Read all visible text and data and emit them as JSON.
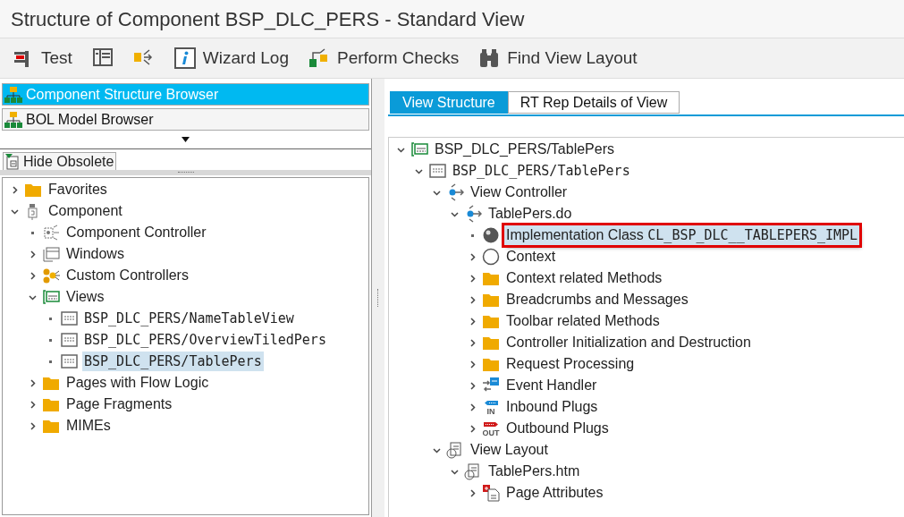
{
  "window": {
    "title": "Structure of Component BSP_DLC_PERS - Standard View"
  },
  "toolbar": [
    {
      "kind": "test",
      "label": "Test"
    },
    {
      "kind": "panel"
    },
    {
      "kind": "flow"
    },
    {
      "kind": "info",
      "label": "Wizard Log"
    },
    {
      "kind": "checks",
      "label": "Perform Checks"
    },
    {
      "kind": "binoculars",
      "label": "Find View Layout"
    }
  ],
  "browsers": [
    {
      "label": "Component Structure Browser",
      "selected": true
    },
    {
      "label": "BOL Model Browser",
      "selected": false
    }
  ],
  "hide_obsolete": {
    "label": "Hide Obsolete"
  },
  "left_tree": [
    {
      "kind": "folder",
      "label": "Favorites",
      "expanded": false,
      "selected": false
    },
    {
      "kind": "component",
      "label": "Component",
      "expanded": true,
      "selected": false,
      "children": [
        {
          "kind": "controller",
          "label": "Component Controller",
          "selected": false
        },
        {
          "kind": "windows",
          "label": "Windows",
          "expanded": false,
          "selected": false
        },
        {
          "kind": "custom",
          "label": "Custom Controllers",
          "expanded": false,
          "selected": false
        },
        {
          "kind": "views",
          "label": "Views",
          "expanded": true,
          "selected": false,
          "children": [
            {
              "kind": "view",
              "code": "BSP_DLC_PERS/NameTableView",
              "selected": false
            },
            {
              "kind": "view",
              "code": "BSP_DLC_PERS/OverviewTiledPers",
              "selected": false
            },
            {
              "kind": "view",
              "code": "BSP_DLC_PERS/TablePers",
              "selected": true
            }
          ]
        },
        {
          "kind": "folder",
          "label": "Pages with Flow Logic",
          "expanded": false,
          "selected": false
        },
        {
          "kind": "folder",
          "label": "Page Fragments",
          "expanded": false,
          "selected": false
        },
        {
          "kind": "folder",
          "label": "MIMEs",
          "expanded": false,
          "selected": false
        }
      ]
    }
  ],
  "tabs": [
    {
      "label": "View Structure",
      "selected": true
    },
    {
      "label": "RT Rep Details of View",
      "selected": false
    }
  ],
  "view_tree": [
    {
      "kind": "views",
      "label": "BSP_DLC_PERS/TablePers",
      "expanded": true,
      "selected": false,
      "children": [
        {
          "kind": "view",
          "code": "BSP_DLC_PERS/TablePers",
          "expanded": true,
          "selected": false,
          "children": [
            {
              "kind": "viewctl",
              "label": "View Controller",
              "expanded": true,
              "selected": false,
              "children": [
                {
                  "kind": "viewctl",
                  "label": "TablePers.do",
                  "expanded": true,
                  "selected": false,
                  "children": [
                    {
                      "kind": "impl",
                      "label": "Implementation Class ",
                      "code": "CL_BSP_DLC__TABLEPERS_IMPL",
                      "selected": true
                    },
                    {
                      "kind": "context",
                      "label": "Context",
                      "expanded": false,
                      "selected": false
                    },
                    {
                      "kind": "folder",
                      "label": "Context related Methods",
                      "expanded": false,
                      "selected": false
                    },
                    {
                      "kind": "folder",
                      "label": "Breadcrumbs and Messages",
                      "expanded": false,
                      "selected": false
                    },
                    {
                      "kind": "folder",
                      "label": "Toolbar related Methods",
                      "expanded": false,
                      "selected": false
                    },
                    {
                      "kind": "folder",
                      "label": "Controller Initialization and Destruction",
                      "expanded": false,
                      "selected": false
                    },
                    {
                      "kind": "folder",
                      "label": "Request Processing",
                      "expanded": false,
                      "selected": false
                    },
                    {
                      "kind": "event",
                      "label": "Event Handler",
                      "expanded": false,
                      "selected": false
                    },
                    {
                      "kind": "inbound",
                      "badge": "IN",
                      "label": "Inbound Plugs",
                      "expanded": false,
                      "selected": false
                    },
                    {
                      "kind": "outbound",
                      "badge": "OUT",
                      "label": "Outbound Plugs",
                      "expanded": false,
                      "selected": false
                    }
                  ]
                }
              ]
            },
            {
              "kind": "layout",
              "label": "View Layout",
              "expanded": true,
              "selected": false,
              "children": [
                {
                  "kind": "layout",
                  "label": "TablePers.htm",
                  "expanded": true,
                  "selected": false,
                  "children": [
                    {
                      "kind": "attrs",
                      "label": "Page Attributes",
                      "expanded": false,
                      "selected": false
                    }
                  ]
                }
              ]
            }
          ]
        }
      ]
    }
  ]
}
